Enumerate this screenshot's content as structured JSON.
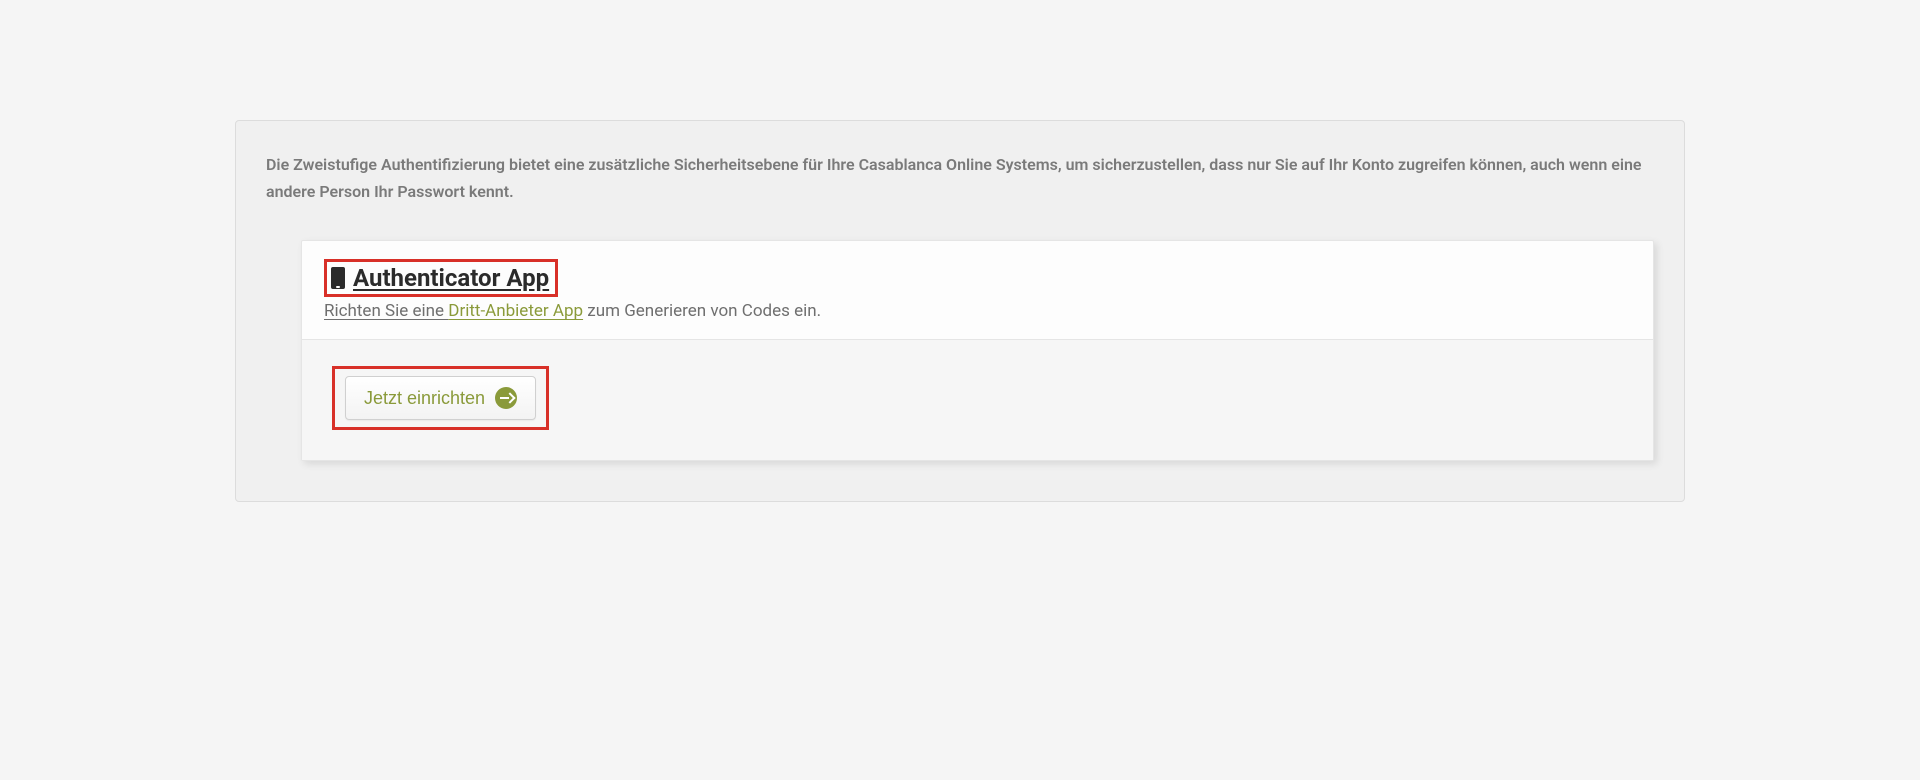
{
  "panel": {
    "description": "Die Zweistufige Authentifizierung bietet eine zusätzliche Sicherheitsebene für Ihre Casablanca Online Systems, um sicherzustellen, dass nur Sie auf Ihr Konto zugreifen können, auch wenn eine andere Person Ihr Passwort kennt."
  },
  "card": {
    "title": "Authenticator App",
    "subtext_prefix": "Richten Sie eine ",
    "subtext_accent": "Dritt-Anbieter App",
    "subtext_suffix": " zum Generieren von Codes ein.",
    "button_label": "Jetzt einrichten"
  }
}
